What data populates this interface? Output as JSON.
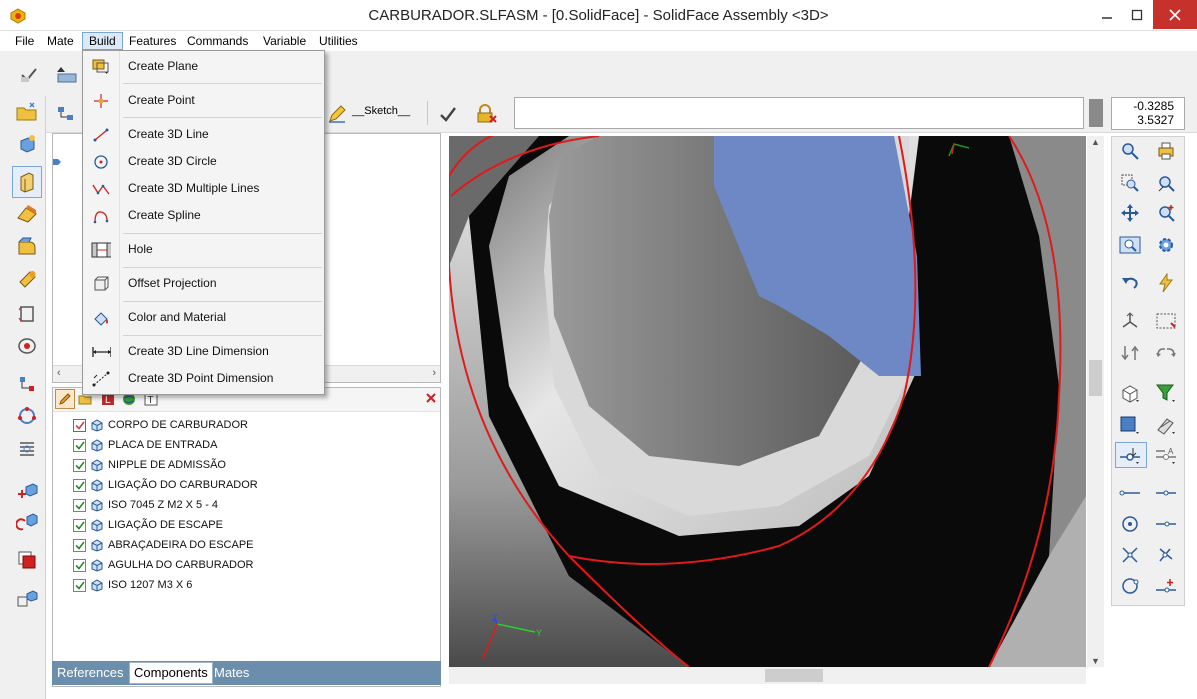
{
  "window": {
    "title": "CARBURADOR.SLFASM - [0.SolidFace] - SolidFace Assembly <3D>"
  },
  "menu": [
    "File",
    "Mate",
    "Build",
    "Features",
    "Commands",
    "Variable",
    "Utilities"
  ],
  "toolbar": {
    "sketch_label": "__Sketch__",
    "coord_x": "-0.3285",
    "coord_y": "3.5327"
  },
  "build_menu": [
    {
      "label": "Create Plane",
      "icon": "plane-icon"
    },
    {
      "label": "Create Point",
      "icon": "point-icon"
    },
    {
      "label": "Create 3D Line",
      "icon": "line-icon"
    },
    {
      "label": "Create 3D Circle",
      "icon": "circle-icon"
    },
    {
      "label": "Create 3D Multiple Lines",
      "icon": "polyline-icon"
    },
    {
      "label": "Create Spline",
      "icon": "spline-icon"
    },
    {
      "label": "Hole",
      "icon": "hole-icon"
    },
    {
      "label": "Offset Projection",
      "icon": "offset-projection-icon"
    },
    {
      "label": "Color and Material",
      "icon": "paint-bucket-icon"
    },
    {
      "label": "Create 3D Line Dimension",
      "icon": "line-dimension-icon"
    },
    {
      "label": "Create 3D Point Dimension",
      "icon": "point-dimension-icon"
    }
  ],
  "components": [
    {
      "label": "CORPO DE CARBURADOR",
      "checked": true,
      "highlight": true
    },
    {
      "label": "PLACA DE ENTRADA",
      "checked": true
    },
    {
      "label": "NIPPLE DE ADMISSÃO",
      "checked": true
    },
    {
      "label": "LIGAÇÃO DO CARBURADOR",
      "checked": true
    },
    {
      "label": "ISO 7045 Z M2 X 5 - 4",
      "checked": true
    },
    {
      "label": "LIGAÇÃO DE ESCAPE",
      "checked": true
    },
    {
      "label": "ABRAÇADEIRA DO ESCAPE",
      "checked": true
    },
    {
      "label": "AGULHA DO CARBURADOR",
      "checked": true
    },
    {
      "label": "ISO 1207 M3 X 6",
      "checked": true
    }
  ],
  "tabs": [
    "References",
    "Components",
    "Mates"
  ],
  "axis": {
    "x": "X",
    "y": "Y",
    "z": "Z"
  },
  "colors": {
    "accent": "#6b8eac",
    "close": "#c7312b",
    "outline": "#e01a1a",
    "face_blue": "#6d88c4"
  }
}
